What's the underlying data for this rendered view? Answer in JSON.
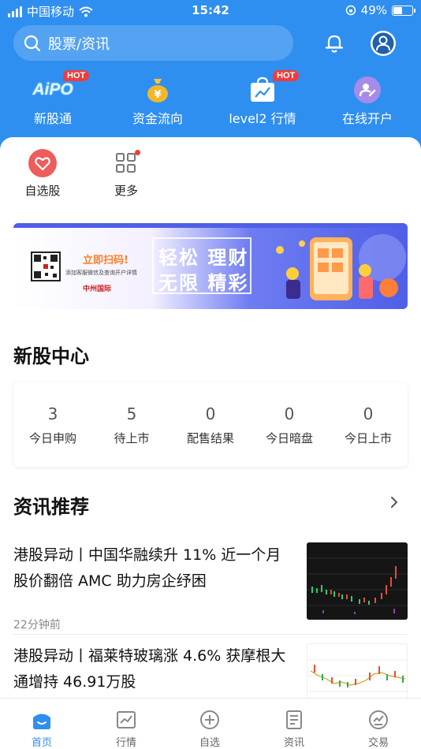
{
  "status_bar": {
    "carrier": "中国移动",
    "time": "15:42",
    "battery": "49%",
    "battery_level": 0.49
  },
  "search": {
    "placeholder": "股票/资讯"
  },
  "header": {
    "bell_icon": "bell-icon",
    "user_icon": "user-icon"
  },
  "quick_actions": [
    {
      "label": "新股通",
      "icon": "aipo-logo",
      "badge": "HOT",
      "logo_text": "AiPO"
    },
    {
      "label": "资金流向",
      "icon": "money-bag-icon",
      "badge": ""
    },
    {
      "label": "level2 行情",
      "icon": "chart-bag-icon",
      "badge": "HOT"
    },
    {
      "label": "在线开户",
      "icon": "account-icon",
      "badge": ""
    }
  ],
  "shortcuts": [
    {
      "label": "自选股",
      "icon": "heart-icon"
    },
    {
      "label": "更多",
      "icon": "grid-icon",
      "dot": true
    }
  ],
  "banner": {
    "scan": "立即扫码!",
    "subtitle": "添加客服微信及查询开户详情",
    "brand": "中州国际",
    "line1": "轻松 理财",
    "line2": "无限 精彩"
  },
  "ipo_center": {
    "title": "新股中心",
    "stats": [
      {
        "value": "3",
        "label": "今日申购"
      },
      {
        "value": "5",
        "label": "待上市"
      },
      {
        "value": "0",
        "label": "配售结果"
      },
      {
        "value": "0",
        "label": "今日暗盘"
      },
      {
        "value": "0",
        "label": "今日上市"
      }
    ]
  },
  "news_section": {
    "title": "资讯推荐",
    "items": [
      {
        "title": "港股异动丨中国华融续升 11% 近一个月股价翻倍 AMC 助力房企纾困",
        "time": "22分钟前"
      },
      {
        "title": "港股异动丨福莱特玻璃涨 4.6% 获摩根大通增持 46.91万股",
        "time": ""
      }
    ]
  },
  "tabbar": [
    {
      "label": "首页",
      "icon": "home-icon",
      "active": true
    },
    {
      "label": "行情",
      "icon": "chart-icon",
      "active": false
    },
    {
      "label": "自选",
      "icon": "plus-circle-icon",
      "active": false
    },
    {
      "label": "资讯",
      "icon": "news-icon",
      "active": false
    },
    {
      "label": "交易",
      "icon": "trade-icon",
      "active": false
    }
  ],
  "colors": {
    "primary": "#2f8ff0",
    "hot_badge": "#f03c3c",
    "heart": "#ee5c5c"
  }
}
